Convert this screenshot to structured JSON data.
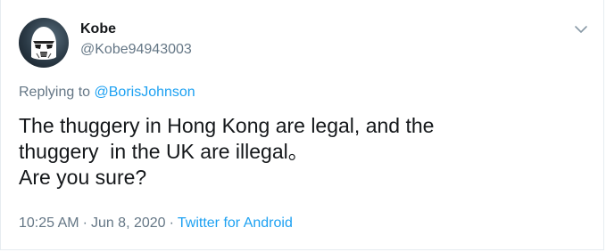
{
  "user": {
    "display_name": "Kobe",
    "handle": "@Kobe94943003",
    "avatar_icon": "stormtrooper-avatar"
  },
  "menu": {
    "icon": "chevron-down-icon"
  },
  "reply": {
    "prefix": "Replying to",
    "mention": "@BorisJohnson"
  },
  "tweet": {
    "text": "The thuggery in Hong Kong are legal, and the\nthuggery  in the UK are illegal。\nAre you sure?"
  },
  "meta": {
    "time": "10:25 AM",
    "separator": "·",
    "date": "Jun 8, 2020",
    "source": "Twitter for Android"
  },
  "colors": {
    "text": "#14171a",
    "secondary": "#657786",
    "link": "#1da1f2",
    "border": "#e6ecf0"
  }
}
